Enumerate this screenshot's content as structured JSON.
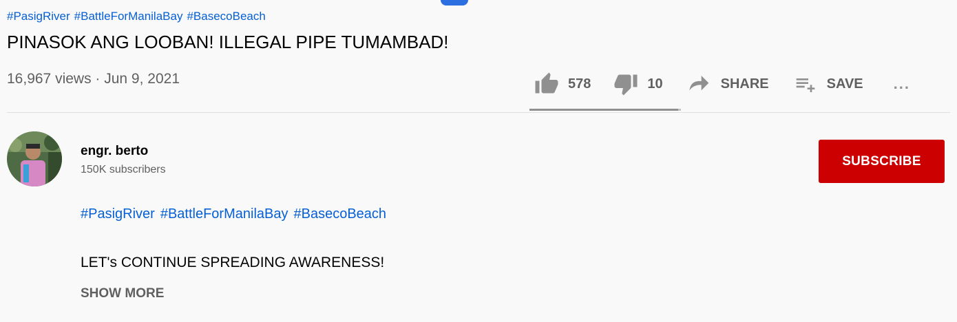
{
  "video": {
    "hashtags": [
      "#PasigRiver",
      "#BattleForManilaBay",
      "#BasecoBeach"
    ],
    "title": "PINASOK ANG LOOBAN! ILLEGAL PIPE TUMAMBAD!",
    "meta": "16,967 views · Jun 9, 2021"
  },
  "actions": {
    "like_count": "578",
    "dislike_count": "10",
    "share_label": "SHARE",
    "save_label": "SAVE",
    "more_label": "...",
    "like_ratio": 0.983
  },
  "channel": {
    "name": "engr. berto",
    "subscribers": "150K subscribers",
    "subscribe_label": "SUBSCRIBE"
  },
  "description": {
    "hashtags": [
      "#PasigRiver",
      "#BattleForManilaBay",
      "#BasecoBeach"
    ],
    "text": "LET's CONTINUE SPREADING AWARENESS!",
    "show_more_label": "SHOW MORE"
  },
  "colors": {
    "link": "#065fd4",
    "subscribe": "#cc0000",
    "secondary_text": "#606060"
  }
}
